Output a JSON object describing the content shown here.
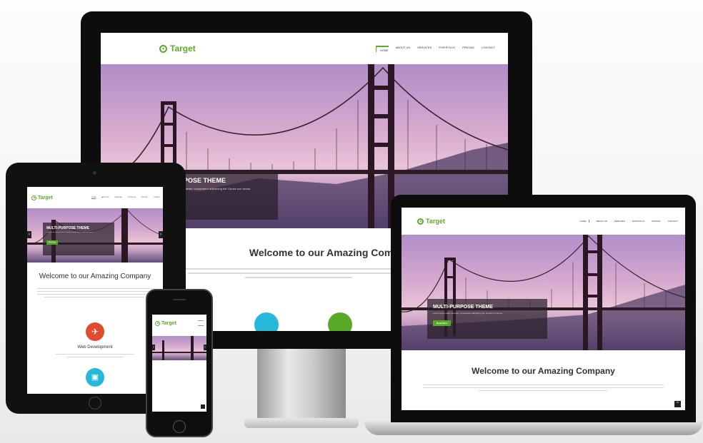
{
  "site": {
    "brand": "Target",
    "nav": [
      "HOME",
      "ABOUT US",
      "SERVICES",
      "PORTFOLIO",
      "PRICING",
      "CONTACT"
    ],
    "hero_title": "MULTI-PURPOSE THEME",
    "hero_title_monitor": "POSE THEME",
    "hero_text": "Lorem ipsum dolor sit amet, consectetur adipiscing elit. Donec non lectus.",
    "hero_text_monitor": "it amet, consectetur adipiscing elit. Donec non lectus.",
    "read_more": "Read More",
    "welcome": "Welcome to our Amazing Company",
    "service_title": "Web Development"
  },
  "colors": {
    "brand_green": "#5aaa2a",
    "service_red": "#e04b2e",
    "service_cyan": "#27b7d8"
  },
  "icons": {
    "logo": "target-icon",
    "service_1": "rocket-icon",
    "service_2": "image-icon",
    "prev": "chevron-left-icon",
    "next": "chevron-right-icon",
    "scroll_top": "chevron-up-icon"
  }
}
